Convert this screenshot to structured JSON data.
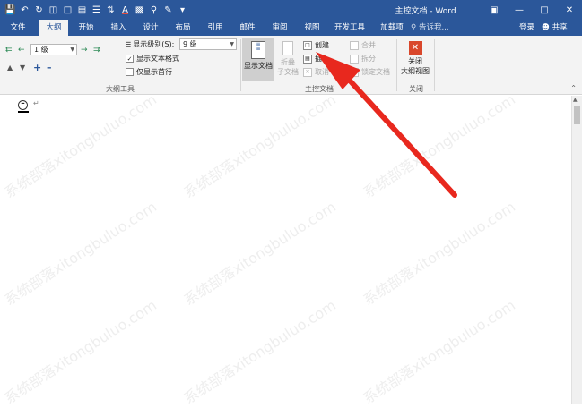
{
  "window": {
    "title": "主控文档 - Word"
  },
  "qat": [
    "save-icon",
    "undo-icon",
    "redo-icon",
    "print-preview-icon",
    "new-doc-icon",
    "paste-icon",
    "align-icon",
    "font-color-icon",
    "abc-icon",
    "search-icon",
    "draw-icon",
    "spacing-icon",
    "more-icon"
  ],
  "tabs": {
    "file": "文件",
    "outline": "大纲",
    "home": "开始",
    "insert": "插入",
    "design": "设计",
    "layout": "布局",
    "references": "引用",
    "mailings": "邮件",
    "review": "审阅",
    "view": "视图",
    "developer": "开发工具",
    "addins": "加载项"
  },
  "tell_me": "告诉我...",
  "login": "登录",
  "share": "共享",
  "outline_tools": {
    "level_value": "1 级",
    "show_level_label": "显示级别(S):",
    "show_level_value": "9 级",
    "show_text_format": "显示文本格式",
    "show_first_line_only": "仅显示首行",
    "group_label": "大纲工具"
  },
  "master_doc": {
    "show_document": "显示文档",
    "collapse_subdocs": [
      "折叠",
      "子文档"
    ],
    "create": "创建",
    "insert": "插入",
    "unlink": "取消",
    "merge": "合并",
    "split": "拆分",
    "lock_document": "锁定文档",
    "group_label": "主控文档"
  },
  "close_group": {
    "close_outline": [
      "关闭",
      "大纲视图"
    ],
    "group_label": "关闭"
  },
  "watermark": "系统部落xitongbuluo.com",
  "annotation_color": "#e8281e",
  "accent_color": "#2b579a"
}
